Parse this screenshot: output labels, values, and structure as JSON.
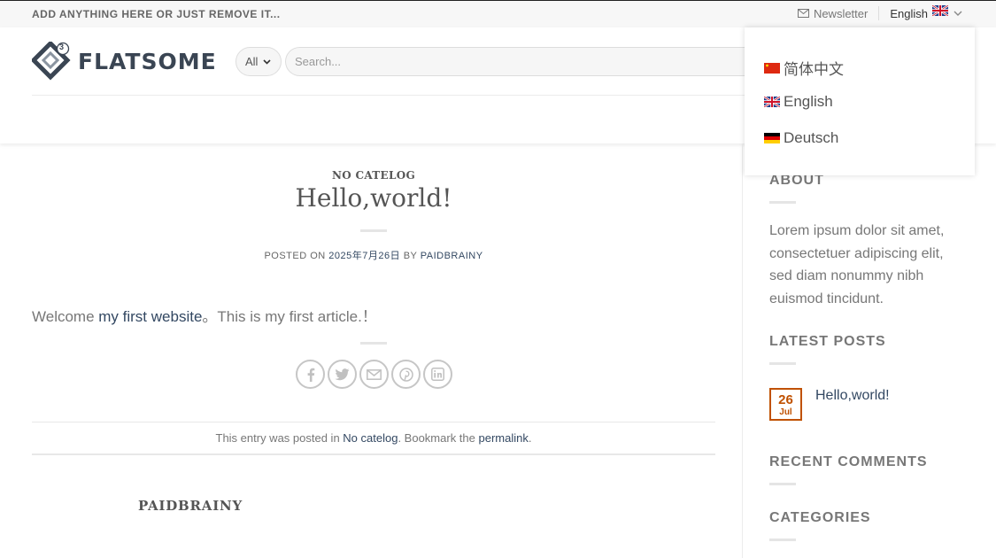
{
  "topbar": {
    "left_text": "ADD ANYTHING HERE OR JUST REMOVE IT...",
    "newsletter": "Newsletter",
    "language": "English"
  },
  "header": {
    "logo_text": "FLATSOME",
    "logo_badge": "3",
    "category_select": "All",
    "search_placeholder": "Search..."
  },
  "language_dropdown": {
    "items": [
      {
        "label": "简体中文",
        "flag": "cn-flag-icon"
      },
      {
        "label": "English",
        "flag": "uk-flag-icon"
      },
      {
        "label": "Deutsch",
        "flag": "de-flag-icon"
      }
    ]
  },
  "article": {
    "category": "NO CATELOG",
    "title": "Hello,world!",
    "meta_posted_on": "POSTED ON",
    "meta_date": "2025年7月26日",
    "meta_by": "BY",
    "meta_author": "PAIDBRAINY",
    "content_prefix": "Welcome ",
    "content_link": "my first website",
    "content_suffix": "。This is my first article.！",
    "share_icons": [
      "facebook-icon",
      "twitter-icon",
      "email-icon",
      "pinterest-icon",
      "linkedin-icon"
    ],
    "footer_prefix": "This entry was posted in ",
    "footer_category": "No catelog",
    "footer_middle": ". Bookmark the ",
    "footer_permalink": "permalink",
    "footer_end": ".",
    "author_name": "PAIDBRAINY"
  },
  "sidebar": {
    "about_title": "ABOUT",
    "about_text": "Lorem ipsum dolor sit amet, consectetuer adipiscing elit, sed diam nonummy nibh euismod tincidunt.",
    "latest_title": "LATEST POSTS",
    "latest_post": {
      "day": "26",
      "month": "Jul",
      "title": "Hello,world!"
    },
    "comments_title": "RECENT COMMENTS",
    "categories_title": "CATEGORIES"
  },
  "colors": {
    "link": "#334862",
    "accent_date": "#c05100",
    "logo": "#3a4553"
  }
}
